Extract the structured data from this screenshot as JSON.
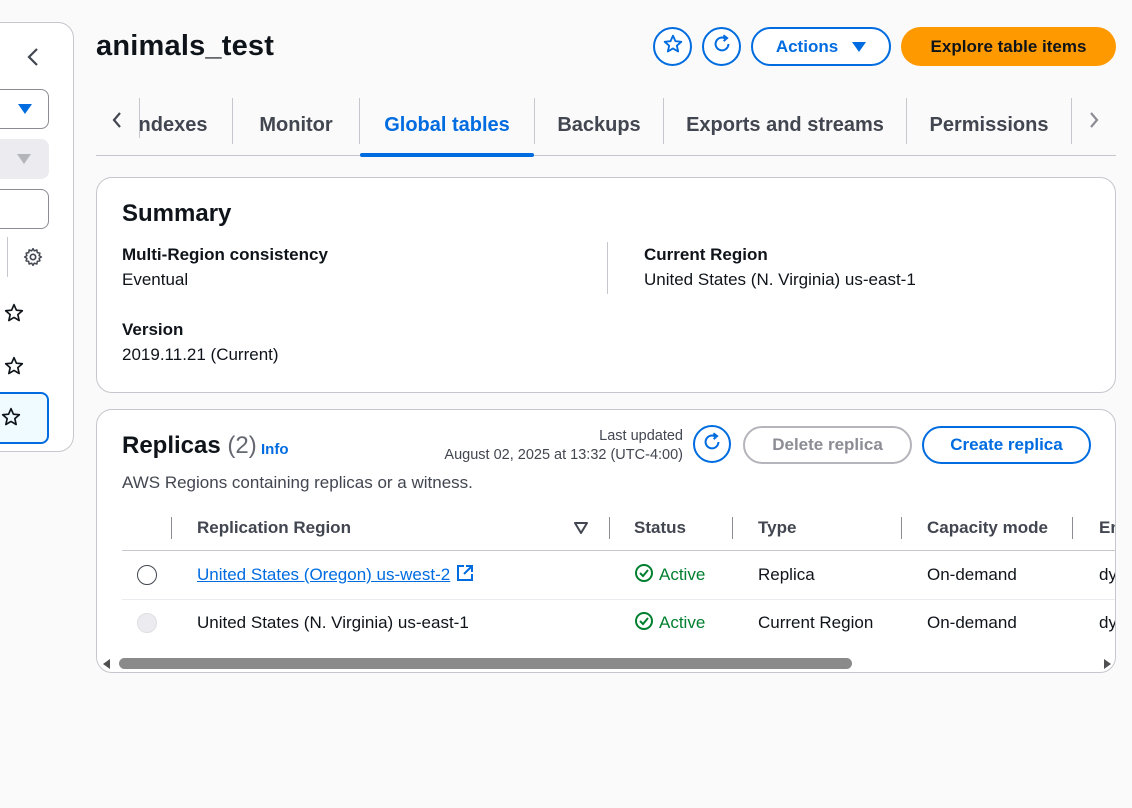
{
  "header": {
    "title": "animals_test",
    "actions_label": "Actions",
    "explore_label": "Explore table items"
  },
  "tabs": [
    {
      "label": "Indexes"
    },
    {
      "label": "Monitor"
    },
    {
      "label": "Global tables",
      "active": true
    },
    {
      "label": "Backups"
    },
    {
      "label": "Exports and streams"
    },
    {
      "label": "Permissions"
    }
  ],
  "summary": {
    "title": "Summary",
    "consistency_label": "Multi-Region consistency",
    "consistency_value": "Eventual",
    "region_label": "Current Region",
    "region_value": "United States (N. Virginia) us-east-1",
    "version_label": "Version",
    "version_value": "2019.11.21 (Current)"
  },
  "replicas": {
    "title": "Replicas",
    "count": "(2)",
    "info": "Info",
    "description": "AWS Regions containing replicas or a witness.",
    "last_updated_label": "Last updated",
    "last_updated_value": "August 02, 2025 at 13:32 (UTC-4:00)",
    "delete_label": "Delete replica",
    "create_label": "Create replica",
    "columns": [
      "Replication Region",
      "Status",
      "Type",
      "Capacity mode",
      "En"
    ],
    "rows": [
      {
        "region": "United States (Oregon) us-west-2",
        "status": "Active",
        "type": "Replica",
        "capacity": "On-demand",
        "extra": "dy"
      },
      {
        "region": "United States (N. Virginia) us-east-1",
        "status": "Active",
        "type": "Current Region",
        "capacity": "On-demand",
        "extra": "dy"
      }
    ]
  },
  "colors": {
    "accent": "#006ce0",
    "primary_button": "#ff9900",
    "success": "#00802f"
  }
}
